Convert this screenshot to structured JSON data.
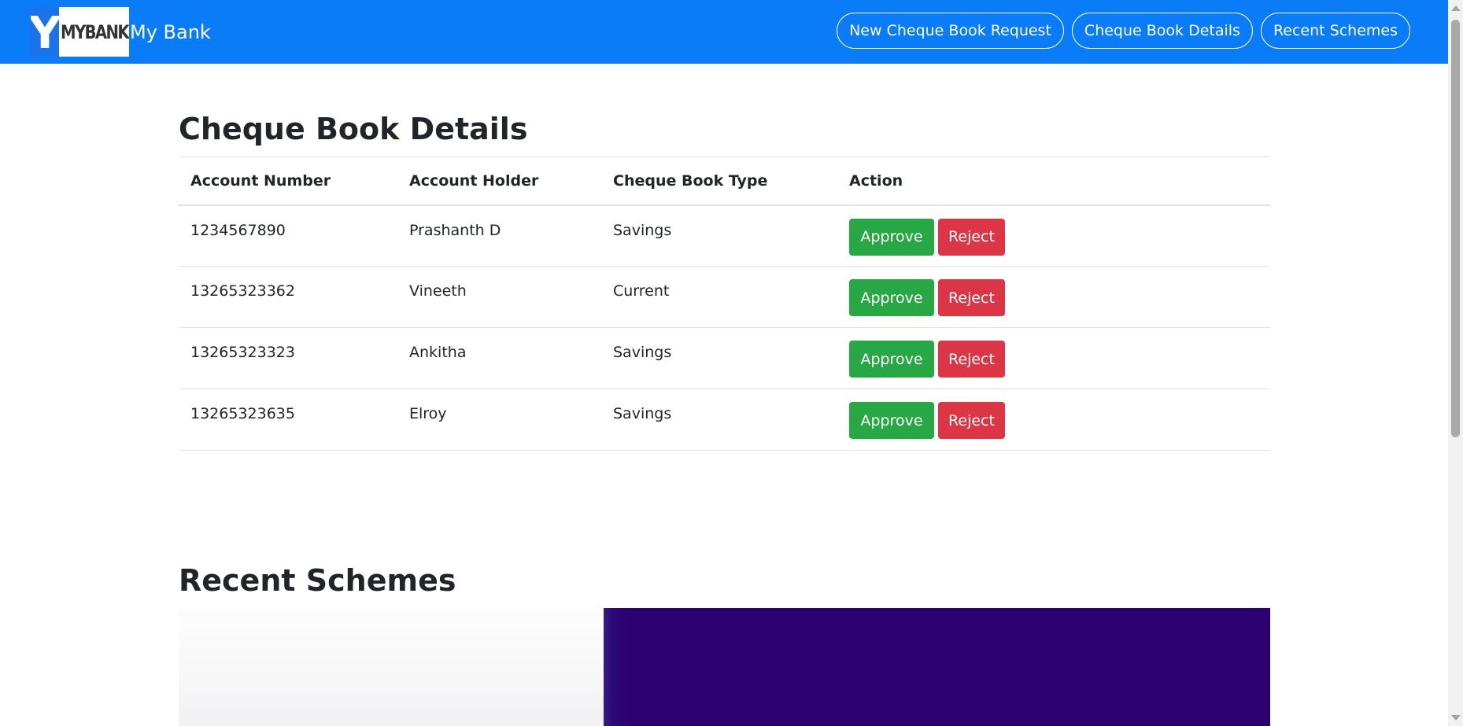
{
  "navbar": {
    "logo_text": "MYBANK",
    "logo_letter": "Y",
    "brand_name": "My Bank",
    "buttons": [
      {
        "label": "New Cheque Book Request"
      },
      {
        "label": "Cheque Book Details"
      },
      {
        "label": "Recent Schemes"
      }
    ],
    "color": "#0a7cf7"
  },
  "cheque_details": {
    "title": "Cheque Book Details",
    "columns": [
      "Account Number",
      "Account Holder",
      "Cheque Book Type",
      "Action"
    ],
    "rows": [
      {
        "account_number": "1234567890",
        "account_holder": "Prashanth D",
        "type": "Savings"
      },
      {
        "account_number": "13265323362",
        "account_holder": "Vineeth",
        "type": "Current"
      },
      {
        "account_number": "13265323323",
        "account_holder": "Ankitha",
        "type": "Savings"
      },
      {
        "account_number": "13265323635",
        "account_holder": "Elroy",
        "type": "Savings"
      }
    ],
    "approve_label": "Approve",
    "reject_label": "Reject",
    "approve_color": "#28a745",
    "reject_color": "#dc3545"
  },
  "schemes": {
    "title": "Recent Schemes"
  }
}
